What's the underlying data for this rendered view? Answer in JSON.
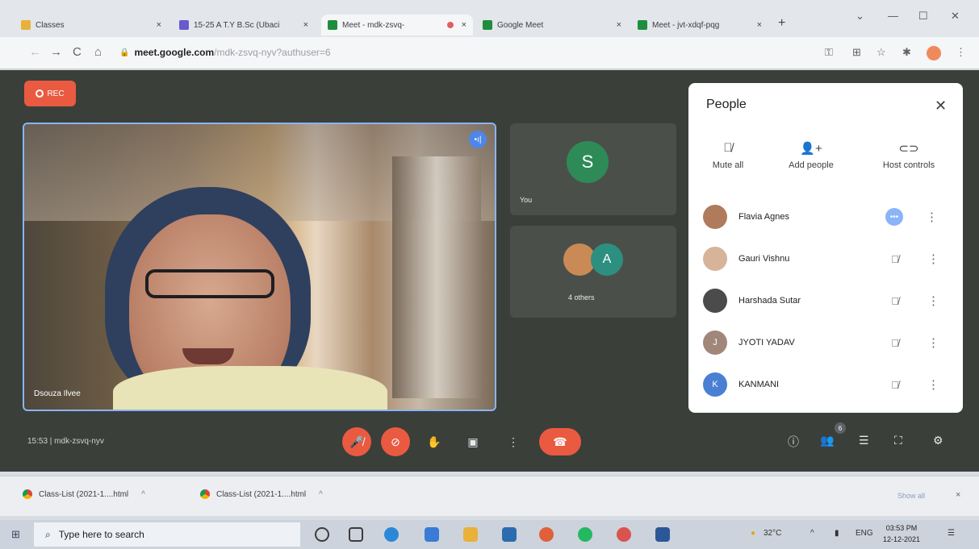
{
  "browser": {
    "tabs": [
      {
        "title": "Classes",
        "favicon_color": "#e8b13a",
        "active": false
      },
      {
        "title": "15-25 A T.Y B.Sc (Ubaci",
        "favicon_color": "#6a5acd",
        "active": false
      },
      {
        "title": "Meet - mdk-zsvq-",
        "favicon_color": "#1e8e3e",
        "active": true,
        "recording": true
      },
      {
        "title": "Google Meet",
        "favicon_color": "#1e8e3e",
        "active": false
      },
      {
        "title": "Meet - jvt-xdqf-pqg",
        "favicon_color": "#1e8e3e",
        "active": false
      }
    ],
    "close_glyph": "×",
    "new_tab_glyph": "+",
    "window_controls": {
      "dropdown": "⌄",
      "minimize": "—",
      "maximize": "☐",
      "close": "✕"
    },
    "nav": {
      "back": "←",
      "forward": "→",
      "reload": "C",
      "home": "⌂"
    },
    "url_host": "meet.google.com",
    "url_path": "/mdk-zsvq-nyv?authuser=6",
    "toolbar_icons": [
      "key-icon",
      "extension-icon",
      "star-icon",
      "puzzle-icon",
      "profile-avatar",
      "menu-icon"
    ],
    "toolbar_glyphs": {
      "key": "⚿",
      "tab": "⊞",
      "star": "☆",
      "puzzle": "✱",
      "menu": "⋮"
    }
  },
  "meet": {
    "rec_label": "REC",
    "main_speaker_label": "Dsouza Ilvee",
    "speaking_glyph": "•ı|",
    "self_tile": {
      "initial": "S",
      "label": "You",
      "avatar_color": "#2e8b57"
    },
    "others_tile": {
      "initial": "A",
      "label": "4 others",
      "avatar_color": "#2d8f7f"
    },
    "meeting_info": "15:53  |  mdk-zsvq-nyv",
    "controls": {
      "mic_glyph": "🎤̸",
      "cam_glyph": "⊘",
      "hand_glyph": "✋",
      "present_glyph": "▣",
      "more_glyph": "⋮",
      "end_glyph": "☎",
      "info_glyph": "ⓘ",
      "people_glyph": "👥",
      "chat_glyph": "☰",
      "activities_glyph": "⛶",
      "lock_glyph": "⚙"
    },
    "people_count": "6"
  },
  "people_panel": {
    "title": "People",
    "close_glyph": "✕",
    "actions": [
      {
        "label": "Mute all",
        "glyph": "🎙̸"
      },
      {
        "label": "Add people",
        "glyph": "👤+"
      },
      {
        "label": "Host controls",
        "glyph": "⊂⊃"
      }
    ],
    "participants": [
      {
        "name": "Flavia Agnes",
        "initial": "",
        "color": "#b07a5c",
        "mic": "speaking",
        "mic_glyph": "•••"
      },
      {
        "name": "Gauri Vishnu",
        "initial": "",
        "color": "#d7b39a",
        "mic": "muted",
        "mic_glyph": "🎙̸"
      },
      {
        "name": "Harshada Sutar",
        "initial": "",
        "color": "#4b4b4b",
        "mic": "muted",
        "mic_glyph": "🎙̸"
      },
      {
        "name": "JYOTI YADAV",
        "initial": "J",
        "color": "#a0877a",
        "mic": "muted",
        "mic_glyph": "🎙̸"
      },
      {
        "name": "KANMANI",
        "initial": "K",
        "color": "#4a7fd4",
        "mic": "muted",
        "mic_glyph": "🎙̸"
      }
    ],
    "more_glyph": "⋮"
  },
  "downloads": {
    "items": [
      {
        "name": "Class-List (2021-1....html",
        "chevron": "^"
      },
      {
        "name": "Class-List (2021-1....html",
        "chevron": "^"
      }
    ],
    "show_all": "Show all",
    "close_glyph": "×"
  },
  "taskbar": {
    "start_glyph": "⊞",
    "search_glyph": "⌕",
    "search_placeholder": "Type here to search",
    "apps": [
      {
        "name": "cortana-icon",
        "color": "#3c3c3c"
      },
      {
        "name": "task-view-icon",
        "color": "#3c3c3c"
      },
      {
        "name": "edge-icon",
        "color": "#2b88d8"
      },
      {
        "name": "photos-icon",
        "color": "#3a7bd5"
      },
      {
        "name": "file-explorer-icon",
        "color": "#e8b13a"
      },
      {
        "name": "store-icon",
        "color": "#2b6cb0"
      },
      {
        "name": "chrome-icon",
        "color": "#e0603a"
      },
      {
        "name": "whatsapp-icon",
        "color": "#25b862"
      },
      {
        "name": "chrome-2-icon",
        "color": "#d9534f"
      },
      {
        "name": "word-icon",
        "color": "#2b5797"
      }
    ],
    "weather": "32°C",
    "tray_up": "^",
    "battery_glyph": "▮",
    "language": "ENG",
    "time": "03:53 PM",
    "date": "12-12-2021",
    "notification_glyph": "☰"
  }
}
